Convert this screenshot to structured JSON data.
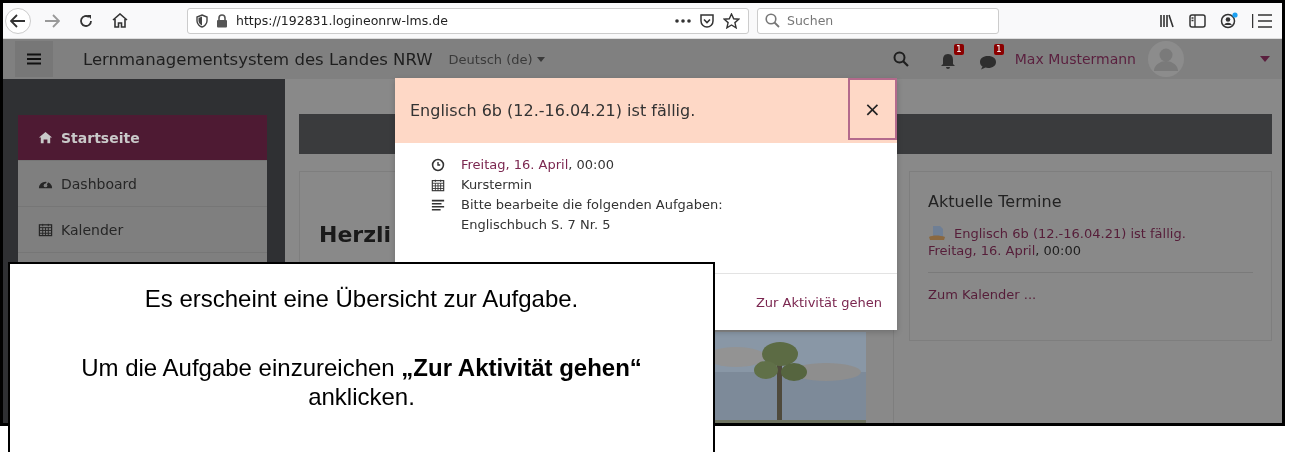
{
  "browser": {
    "url": "https://192831.logineonrw-lms.de",
    "search": {
      "placeholder": "Suchen"
    }
  },
  "navbar": {
    "site_title": "Lernmanagementsystem des Landes NRW",
    "language": "Deutsch (de)",
    "notification_count": "1",
    "message_count": "1",
    "user_name": "Max Mustermann"
  },
  "sidebar": {
    "items": [
      {
        "label": "Startseite",
        "kind": "home",
        "selected": true
      },
      {
        "label": "Dashboard",
        "kind": "dashboard",
        "selected": false
      },
      {
        "label": "Kalender",
        "kind": "calendar",
        "selected": false
      }
    ]
  },
  "main": {
    "heading": "Herzli",
    "upcoming_events": {
      "title": "Aktuelle Termine",
      "event": "Englisch 6b (12.-16.04.21) ist fällig.",
      "date": "Freitag, 16. April",
      "time": ", 00:00",
      "calendar_link": "Zum Kalender ..."
    }
  },
  "modal": {
    "title": "Englisch 6b (12.-16.04.21) ist fällig.",
    "close": "×",
    "rows": [
      {
        "kind": "time",
        "link": "Freitag, 16. April",
        "text": ", 00:00"
      },
      {
        "kind": "type",
        "text": "Kurstermin"
      },
      {
        "kind": "description",
        "lines": [
          "Bitte bearbeite die folgenden Aufgaben:",
          "Englischbuch S. 7 Nr. 5"
        ]
      }
    ],
    "action": "Zur Aktivität gehen"
  },
  "callout": {
    "lines": [
      "Es erscheint eine Übersicht zur Aufgabe.",
      "Um die Aufgabe einzureichen **„Zur Aktivität gehen“** anklicken."
    ]
  }
}
